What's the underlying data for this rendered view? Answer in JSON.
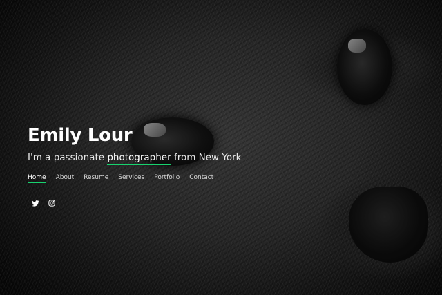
{
  "hero": {
    "name": "Emily Lour",
    "tagline_prefix": "I'm a passionate ",
    "tagline_highlight": "photographer",
    "tagline_suffix": " from New York",
    "accent_color": "#18d26e"
  },
  "nav": {
    "items": [
      {
        "label": "Home",
        "active": true
      },
      {
        "label": "About"
      },
      {
        "label": "Resume"
      },
      {
        "label": "Services"
      },
      {
        "label": "Portfolio"
      },
      {
        "label": "Contact"
      }
    ]
  },
  "social": {
    "icons": [
      "twitter-icon",
      "instagram-icon"
    ]
  }
}
